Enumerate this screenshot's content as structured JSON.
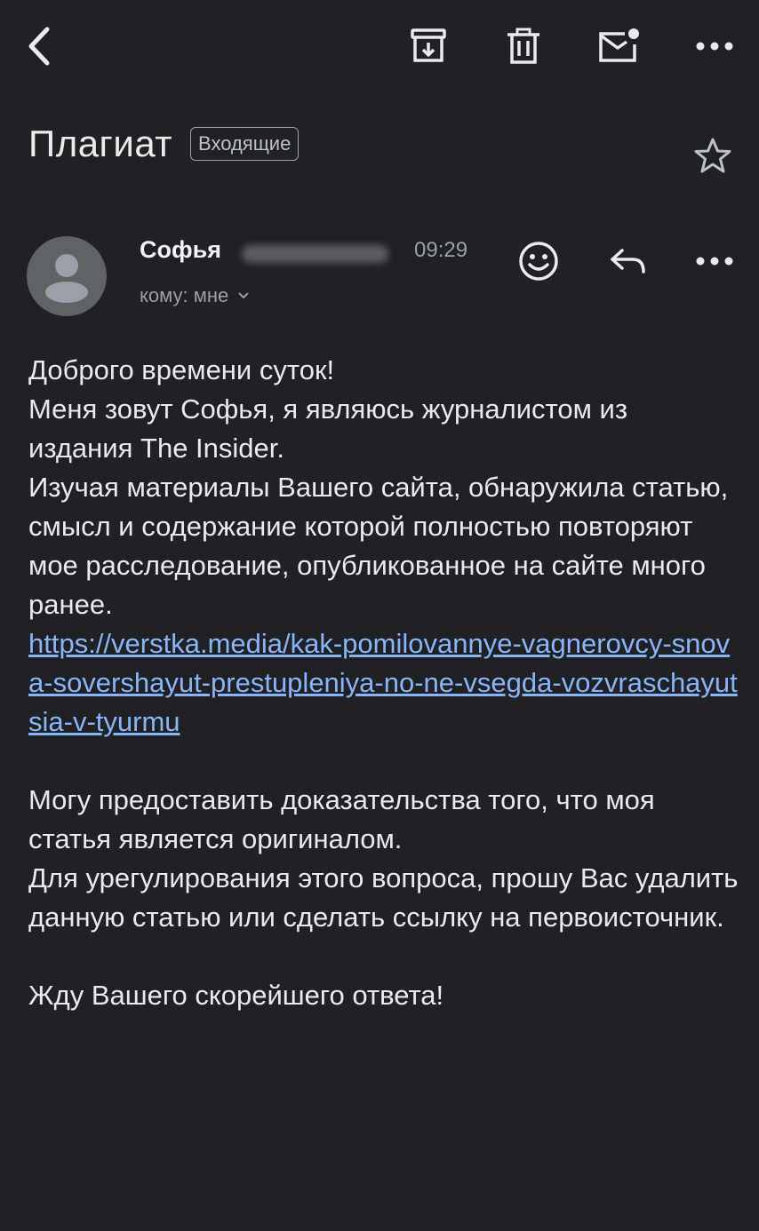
{
  "toolbar": {
    "back_icon": "chevron-left-icon",
    "archive_icon": "archive-icon",
    "delete_icon": "trash-icon",
    "unread_icon": "mark-unread-icon",
    "more_icon": "more-horizontal-icon"
  },
  "message": {
    "subject": "Плагиат",
    "label": "Входящие",
    "sender_name": "Софья",
    "time": "09:29",
    "recipient": "кому: мне",
    "body": {
      "greeting": "Доброго времени суток!",
      "para1": "Меня зовут Софья, я являюсь журналистом из издания The Insider.\nИзучая материалы Вашего сайта, обнаружила статью, смысл и содержание которой полностью повторяют мое расследование, опубликованное на сайте  много ранее.",
      "link": "https://verstka.media/kak-pomilovannye-vagnerovcy-snova-sovershayut-prestupleniya-no-ne-vsegda-vozvraschayutsia-v-tyurmu",
      "para2": "Могу предоставить доказательства того, что моя статья является оригиналом.\nДля урегулирования этого вопроса, прошу Вас удалить данную статью или сделать ссылку на первоисточник.",
      "closing": "Жду Вашего скорейшего ответа!"
    }
  },
  "colors": {
    "background": "#202124",
    "link": "#8ab4f8",
    "secondary_text": "#9aa0a6"
  }
}
